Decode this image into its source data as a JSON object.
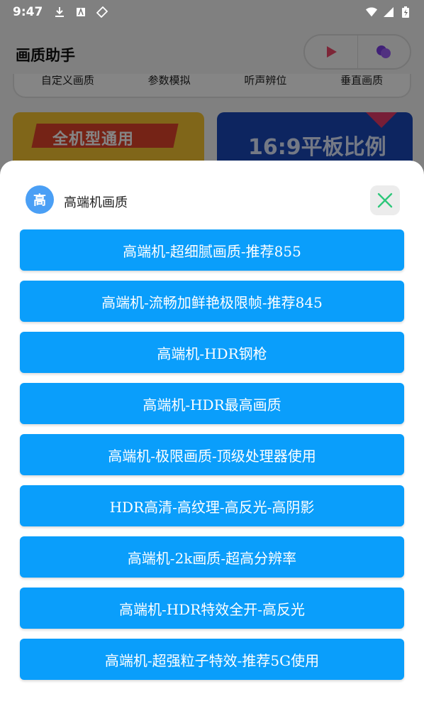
{
  "status_bar": {
    "time": "9:47"
  },
  "app": {
    "title": "画质助手",
    "tabs": [
      "自定义画质",
      "参数模拟",
      "听声辨位",
      "垂直画质"
    ],
    "banners": [
      {
        "text": "全机型通用"
      },
      {
        "text": "16:9平板比例"
      }
    ]
  },
  "sheet": {
    "avatar_text": "高",
    "title": "高端机画质",
    "options": [
      "高端机-超细腻画质-推荐855",
      "高端机-流畅加鲜艳极限帧-推荐845",
      "高端机-HDR钢枪",
      "高端机-HDR最高画质",
      "高端机-极限画质-顶级处理器使用",
      "HDR高清-高纹理-高反光-高阴影",
      "高端机-2k画质-超高分辨率",
      "高端机-HDR特效全开-高反光",
      "高端机-超强粒子特效-推荐5G使用"
    ]
  },
  "colors": {
    "accent": "#0a9efb",
    "avatar": "#4a9ff5",
    "close_icon": "#2ec77a"
  },
  "icons": {
    "close": "close-icon",
    "download": "download-icon",
    "wifi": "wifi-icon",
    "signal": "signal-icon",
    "battery": "battery-icon"
  }
}
